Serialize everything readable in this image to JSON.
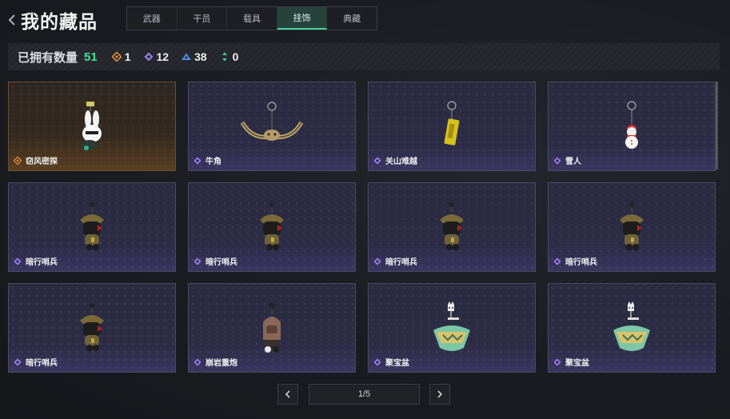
{
  "header": {
    "title": "我的藏品"
  },
  "tabs": [
    {
      "label": "武器",
      "active": false
    },
    {
      "label": "干员",
      "active": false
    },
    {
      "label": "载具",
      "active": false
    },
    {
      "label": "挂饰",
      "active": true
    },
    {
      "label": "典藏",
      "active": false
    }
  ],
  "owned": {
    "label": "已拥有数量",
    "total": "51",
    "counts": [
      {
        "value": "1",
        "icon": "gold-rarity-icon",
        "color": "#e08a3c"
      },
      {
        "value": "12",
        "icon": "purple-rarity-icon",
        "color": "#9b7bf0"
      },
      {
        "value": "38",
        "icon": "blue-rarity-icon",
        "color": "#4d8ee8"
      },
      {
        "value": "0",
        "icon": "green-rarity-icon",
        "color": "#3fd39a"
      }
    ]
  },
  "items": [
    {
      "name": "窃风密探",
      "rarity": "gold",
      "art": "rabbit"
    },
    {
      "name": "牛角",
      "rarity": "purple",
      "art": "horn"
    },
    {
      "name": "关山难越",
      "rarity": "purple",
      "art": "lighter"
    },
    {
      "name": "雪人",
      "rarity": "purple",
      "art": "snowman"
    },
    {
      "name": "暗行哨兵",
      "rarity": "purple",
      "art": "sentinel"
    },
    {
      "name": "暗行哨兵",
      "rarity": "purple",
      "art": "sentinel"
    },
    {
      "name": "暗行哨兵",
      "rarity": "purple",
      "art": "sentinel"
    },
    {
      "name": "暗行哨兵",
      "rarity": "purple",
      "art": "sentinel"
    },
    {
      "name": "暗行哨兵",
      "rarity": "purple",
      "art": "sentinel"
    },
    {
      "name": "崩岩重炮",
      "rarity": "purple",
      "art": "cannon"
    },
    {
      "name": "聚宝盆",
      "rarity": "purple",
      "art": "bowl"
    },
    {
      "name": "聚宝盆",
      "rarity": "purple",
      "art": "bowl"
    }
  ],
  "pager": {
    "text": "1/5"
  }
}
